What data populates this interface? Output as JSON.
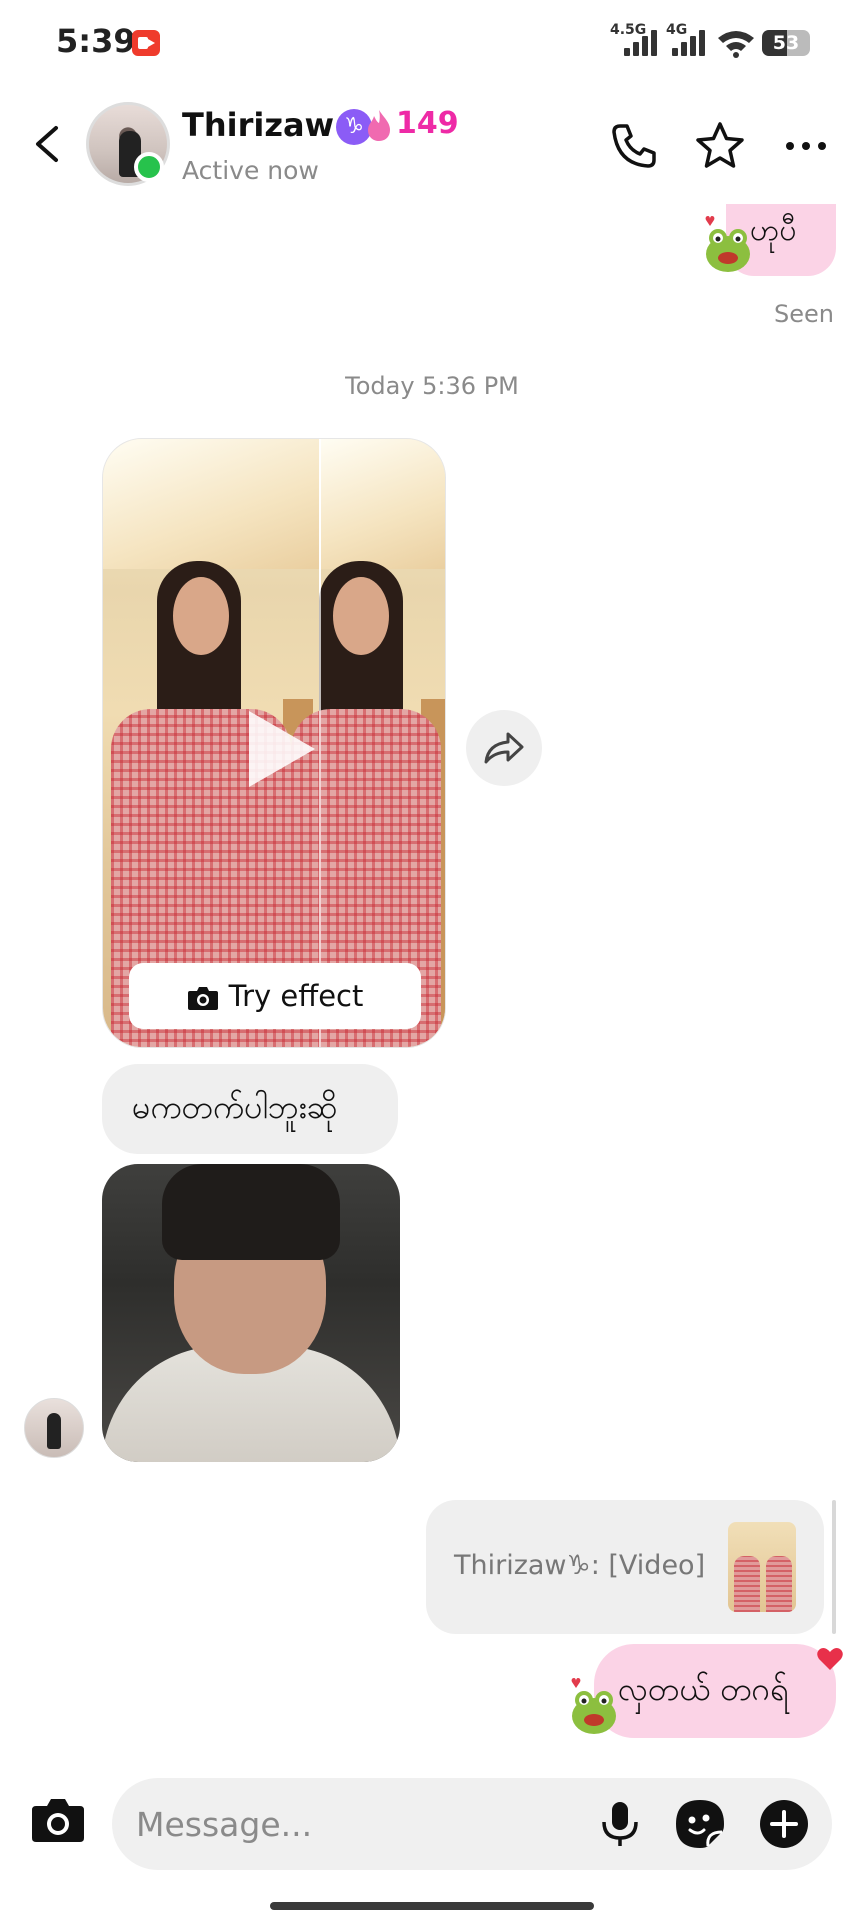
{
  "status_bar": {
    "time": "5:39",
    "network_1": "4.5G",
    "network_2": "4G",
    "battery": "53",
    "battery_level": 0.53
  },
  "header": {
    "contact_name": "Thirizaw",
    "zodiac": "♑",
    "streak_count": "149",
    "status": "Active now"
  },
  "messages": {
    "outgoing_1": "ဟုပီ",
    "seen_label": "Seen",
    "timestamp": "Today 5:36 PM",
    "video_card": {
      "try_effect_label": "Try effect"
    },
    "incoming_text": "မကတက်ပါဘူးဆို",
    "reply_preview": "Thirizaw♑: [Video]",
    "outgoing_last": "လှတယ် တဂရ်"
  },
  "composer": {
    "placeholder": "Message..."
  },
  "colors": {
    "outgoing_bubble": "#fbd3e6",
    "incoming_bubble": "#efefef",
    "streak": "#ee2aa6",
    "online": "#27c24c",
    "zodiac_badge": "#8b5cf6"
  }
}
